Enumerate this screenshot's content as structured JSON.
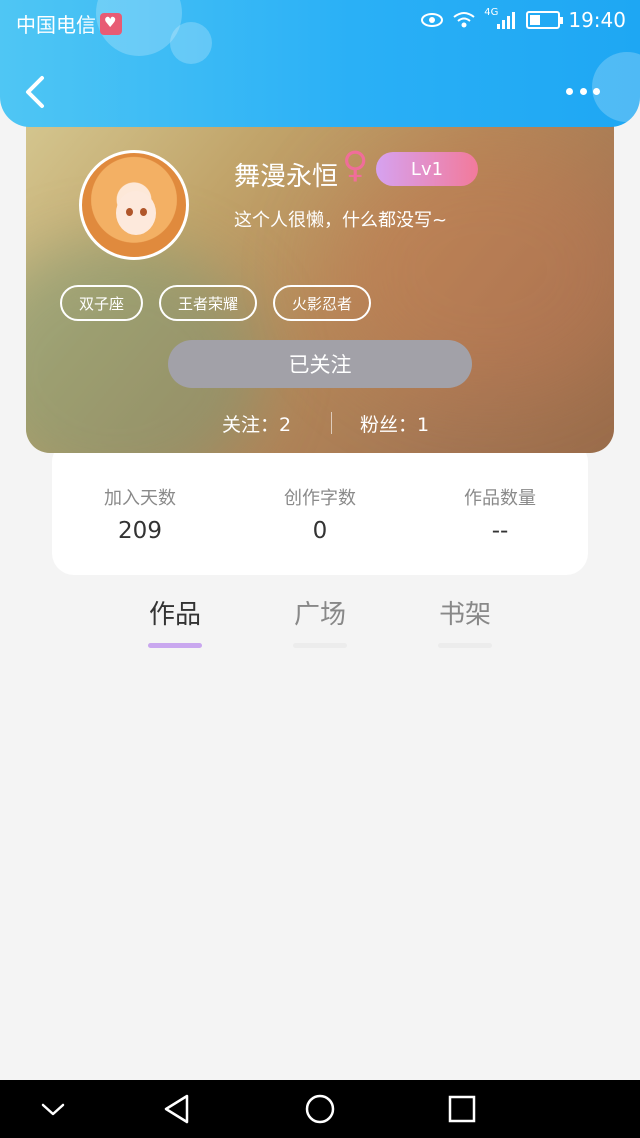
{
  "status_bar": {
    "carrier": "中国电信",
    "network": "4G",
    "time": "19:40"
  },
  "header": {
    "back_icon": "chevron-left-icon",
    "more_icon": "more-horizontal-icon"
  },
  "profile": {
    "name": "舞漫永恒",
    "gender_icon": "female-icon",
    "level": "Lv1",
    "bio": "这个人很懒，什么都没写~",
    "tags": [
      "双子座",
      "王者荣耀",
      "火影忍者"
    ],
    "follow_button": "已关注",
    "following_label": "关注：2",
    "fans_label": "粉丝：1"
  },
  "stats": [
    {
      "label": "加入天数",
      "value": "209"
    },
    {
      "label": "创作字数",
      "value": "0"
    },
    {
      "label": "作品数量",
      "value": "--"
    }
  ],
  "tabs": [
    {
      "label": "作品",
      "active": true
    },
    {
      "label": "广场",
      "active": false
    },
    {
      "label": "书架",
      "active": false
    }
  ],
  "colors": {
    "header_blue": "#2ab0f6",
    "level_gradient_start": "#d6a2f0",
    "level_gradient_end": "#f27a9b",
    "active_tab_underline": "#c9a7ef",
    "follow_button": "#a2a1a8"
  },
  "nav_bar": {
    "icons": [
      "chevron-down-icon",
      "back-triangle-icon",
      "home-circle-icon",
      "recent-square-icon"
    ]
  }
}
